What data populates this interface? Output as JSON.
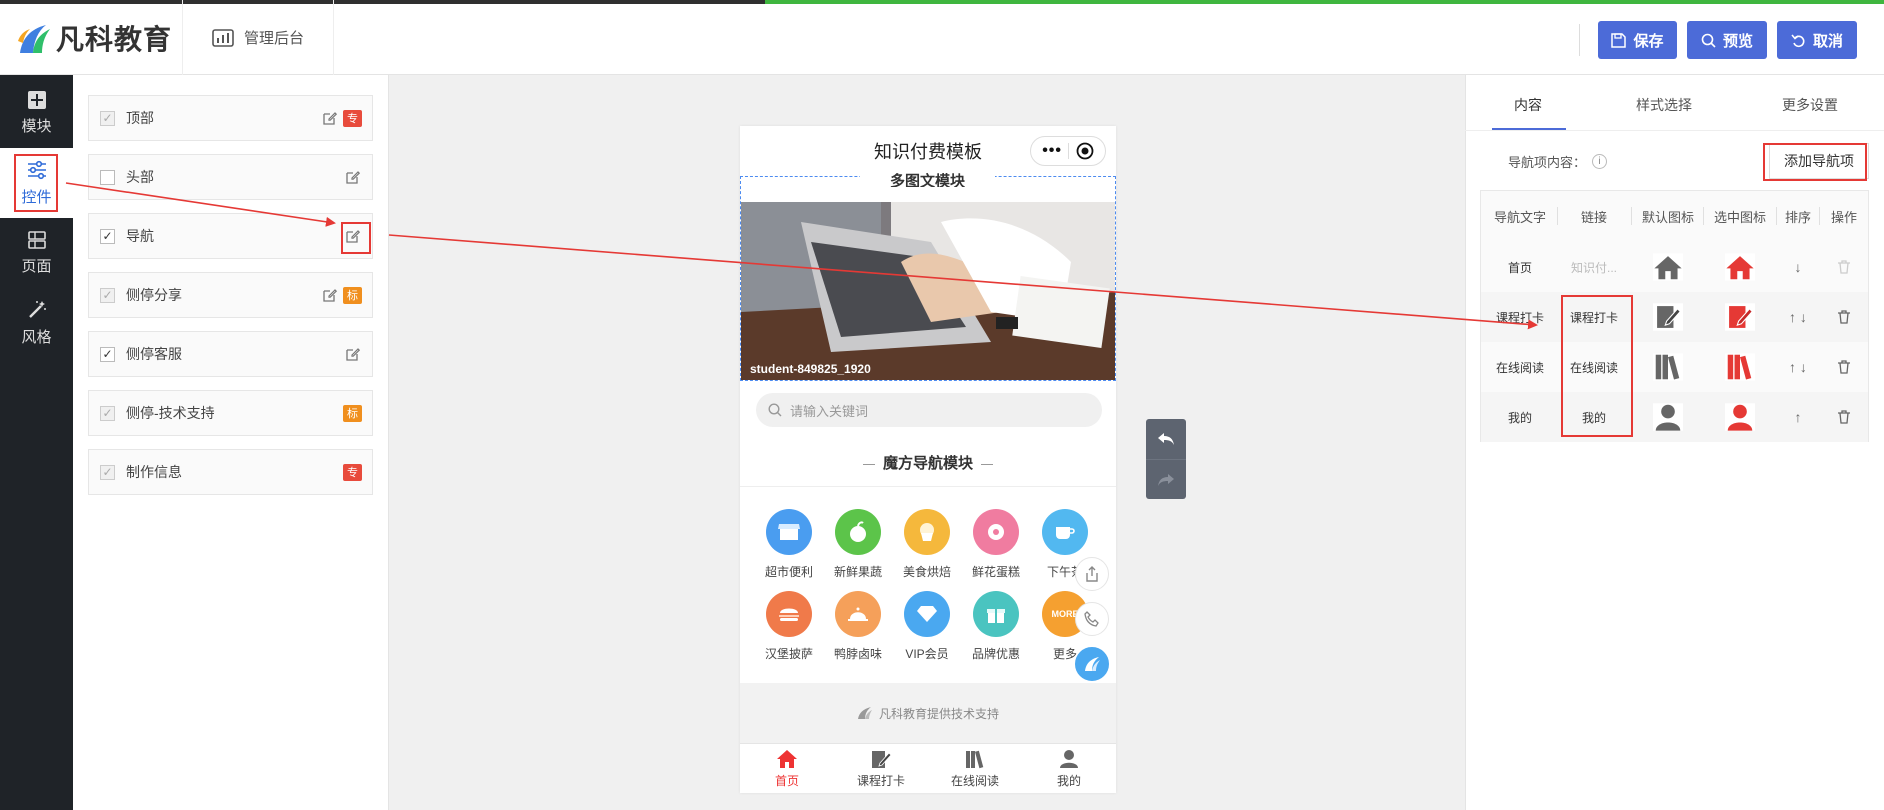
{
  "header": {
    "logo_text": "凡科教育",
    "admin_label": "管理后台",
    "save_label": "保存",
    "preview_label": "预览",
    "cancel_label": "取消",
    "accent": "#4c6bd8"
  },
  "leftnav": {
    "items": [
      {
        "label": "模块",
        "icon": "plus-square-icon"
      },
      {
        "label": "控件",
        "icon": "sliders-icon"
      },
      {
        "label": "页面",
        "icon": "layout-icon"
      },
      {
        "label": "风格",
        "icon": "magic-wand-icon"
      }
    ]
  },
  "components": {
    "items": [
      {
        "label": "顶部",
        "badge": "专"
      },
      {
        "label": "头部",
        "badge": ""
      },
      {
        "label": "导航",
        "badge": ""
      },
      {
        "label": "侧停分享",
        "badge": "标"
      },
      {
        "label": "侧停客服",
        "badge": ""
      },
      {
        "label": "侧停-技术支持",
        "badge": "标"
      },
      {
        "label": "制作信息",
        "badge": "专"
      }
    ]
  },
  "phone": {
    "title": "知识付费模板",
    "slider_title": "多图文模块",
    "photo_caption": "student-849825_1920",
    "search_placeholder": "请输入关键词",
    "magic_title": "魔方导航模块",
    "magic_items": [
      {
        "label": "超市便利",
        "color": "#4a9df0"
      },
      {
        "label": "新鲜果蔬",
        "color": "#5cc44a"
      },
      {
        "label": "美食烘焙",
        "color": "#f5b83c"
      },
      {
        "label": "鲜花蛋糕",
        "color": "#f07ca0"
      },
      {
        "label": "下午茶",
        "color": "#52b8f0"
      },
      {
        "label": "汉堡披萨",
        "color": "#f07a4a"
      },
      {
        "label": "鸭脖卤味",
        "color": "#f5a05a"
      },
      {
        "label": "VIP会员",
        "color": "#4aa8f0"
      },
      {
        "label": "品牌优惠",
        "color": "#4ac4c0"
      },
      {
        "label": "更多",
        "color": "#f5a030",
        "text": "MORE"
      }
    ],
    "footer_tech": "凡科教育提供技术支持",
    "tabs": [
      {
        "label": "首页",
        "active": true
      },
      {
        "label": "课程打卡",
        "active": false
      },
      {
        "label": "在线阅读",
        "active": false
      },
      {
        "label": "我的",
        "active": false
      }
    ]
  },
  "right_panel": {
    "tabs": [
      "内容",
      "样式选择",
      "更多设置"
    ],
    "nav_content_label": "导航项内容：",
    "info_glyph": "i",
    "add_nav_label": "添加导航项",
    "table_headers": [
      "导航文字",
      "链接",
      "默认图标",
      "选中图标",
      "排序",
      "操作"
    ],
    "rows": [
      {
        "text": "首页",
        "link": "知识付...",
        "icon": "home-icon",
        "sort": "↓"
      },
      {
        "text": "课程打卡",
        "link": "课程打卡",
        "icon": "edit-note-icon",
        "sort": "↑ ↓"
      },
      {
        "text": "在线阅读",
        "link": "在线阅读",
        "icon": "books-icon",
        "sort": "↑ ↓"
      },
      {
        "text": "我的",
        "link": "我的",
        "icon": "user-icon",
        "sort": "↑"
      }
    ],
    "icon_default_color": "#666666",
    "icon_selected_color": "#e53935"
  }
}
